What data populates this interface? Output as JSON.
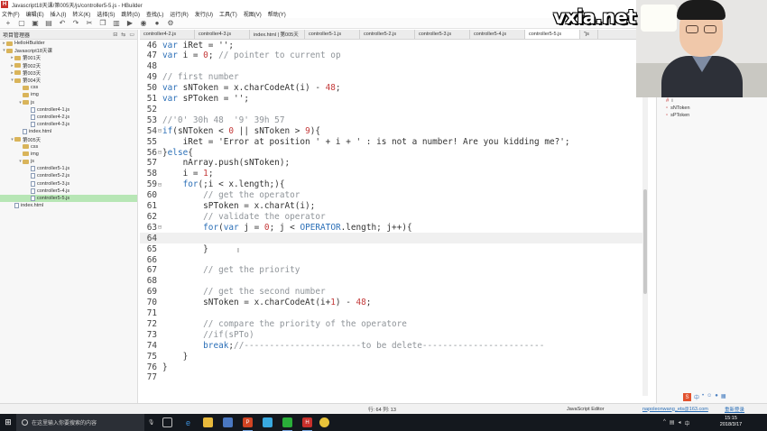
{
  "window": {
    "title": "Javascript18天课/第005天/js/controller5-5.js  -  HBuilder",
    "logo_letter": "H"
  },
  "menu": [
    "文件(F)",
    "编辑(E)",
    "插入(I)",
    "转义(K)",
    "选择(S)",
    "跳转(G)",
    "查找(L)",
    "运行(R)",
    "发行(U)",
    "工具(T)",
    "视图(V)",
    "帮助(Y)"
  ],
  "toolbar_icons": [
    "new-file-icon",
    "open-icon",
    "save-icon",
    "save-all-icon",
    "undo-icon",
    "redo-icon",
    "cut-icon",
    "copy-icon",
    "paste-icon",
    "run-icon",
    "browser-icon",
    "debug-icon",
    "settings-icon"
  ],
  "sidebar": {
    "title": "项目管理器",
    "items": [
      {
        "label": "HelloHBuilder",
        "depth": 0,
        "kind": "folder",
        "twisty": "▸"
      },
      {
        "label": "Javascript18天课",
        "depth": 0,
        "kind": "folder",
        "twisty": "▾"
      },
      {
        "label": "第001天",
        "depth": 1,
        "kind": "folder",
        "twisty": "▸"
      },
      {
        "label": "第002天",
        "depth": 1,
        "kind": "folder",
        "twisty": "▸"
      },
      {
        "label": "第003天",
        "depth": 1,
        "kind": "folder",
        "twisty": "▸"
      },
      {
        "label": "第004天",
        "depth": 1,
        "kind": "folder",
        "twisty": "▾"
      },
      {
        "label": "css",
        "depth": 2,
        "kind": "folder",
        "twisty": ""
      },
      {
        "label": "img",
        "depth": 2,
        "kind": "folder",
        "twisty": ""
      },
      {
        "label": "js",
        "depth": 2,
        "kind": "folder",
        "twisty": "▾"
      },
      {
        "label": "controller4-1.js",
        "depth": 3,
        "kind": "file",
        "twisty": ""
      },
      {
        "label": "controller4-2.js",
        "depth": 3,
        "kind": "file",
        "twisty": ""
      },
      {
        "label": "controller4-3.js",
        "depth": 3,
        "kind": "file",
        "twisty": ""
      },
      {
        "label": "index.html",
        "depth": 2,
        "kind": "file",
        "twisty": ""
      },
      {
        "label": "第005天",
        "depth": 1,
        "kind": "folder",
        "twisty": "▾"
      },
      {
        "label": "css",
        "depth": 2,
        "kind": "folder",
        "twisty": ""
      },
      {
        "label": "img",
        "depth": 2,
        "kind": "folder",
        "twisty": ""
      },
      {
        "label": "js",
        "depth": 2,
        "kind": "folder",
        "twisty": "▾"
      },
      {
        "label": "controller5-1.js",
        "depth": 3,
        "kind": "file",
        "twisty": ""
      },
      {
        "label": "controller5-2.js",
        "depth": 3,
        "kind": "file",
        "twisty": ""
      },
      {
        "label": "controller5-3.js",
        "depth": 3,
        "kind": "file",
        "twisty": ""
      },
      {
        "label": "controller5-4.js",
        "depth": 3,
        "kind": "file",
        "twisty": ""
      },
      {
        "label": "controller5-5.js",
        "depth": 3,
        "kind": "file",
        "twisty": "",
        "selected": true
      },
      {
        "label": "index.html",
        "depth": 1,
        "kind": "file",
        "twisty": ""
      }
    ]
  },
  "tabs": [
    {
      "label": "controller4-2.js"
    },
    {
      "label": "controller4-3.js"
    },
    {
      "label": "index.html | 第005天"
    },
    {
      "label": "controller5-1.js"
    },
    {
      "label": "controller5-2.js"
    },
    {
      "label": "controller5-3.js"
    },
    {
      "label": "controller5-4.js"
    },
    {
      "label": "controller5-5.js",
      "active": true
    },
    {
      "label": "\"js"
    }
  ],
  "editor": {
    "current_line": 64,
    "lines": [
      {
        "n": "46",
        "fold": "",
        "tokens": [
          [
            "kw",
            "var"
          ],
          [
            "idv",
            " iRet = "
          ],
          [
            "str",
            "''"
          ],
          [
            "idv",
            ";"
          ]
        ]
      },
      {
        "n": "47",
        "fold": "",
        "tokens": [
          [
            "kw",
            "var"
          ],
          [
            "idv",
            " i = "
          ],
          [
            "num",
            "0"
          ],
          [
            "idv",
            "; "
          ],
          [
            "cm",
            "// pointer to current op"
          ]
        ]
      },
      {
        "n": "48",
        "fold": "",
        "tokens": []
      },
      {
        "n": "49",
        "fold": "",
        "tokens": [
          [
            "cm",
            "// first number"
          ]
        ]
      },
      {
        "n": "50",
        "fold": "",
        "tokens": [
          [
            "kw",
            "var"
          ],
          [
            "idv",
            " sNToken = x.charCodeAt(i) - "
          ],
          [
            "num",
            "48"
          ],
          [
            "idv",
            ";"
          ]
        ]
      },
      {
        "n": "51",
        "fold": "",
        "tokens": [
          [
            "kw",
            "var"
          ],
          [
            "idv",
            " sPToken = "
          ],
          [
            "str",
            "''"
          ],
          [
            "idv",
            ";"
          ]
        ]
      },
      {
        "n": "52",
        "fold": "",
        "tokens": []
      },
      {
        "n": "53",
        "fold": "",
        "tokens": [
          [
            "cm",
            "//'0' 30h 48  '9' 39h 57"
          ]
        ]
      },
      {
        "n": "54",
        "fold": "⊟",
        "tokens": [
          [
            "kw",
            "if"
          ],
          [
            "idv",
            "(sNToken < "
          ],
          [
            "num",
            "0"
          ],
          [
            "idv",
            " || sNToken > "
          ],
          [
            "num",
            "9"
          ],
          [
            "idv",
            "){"
          ]
        ]
      },
      {
        "n": "55",
        "fold": "",
        "tokens": [
          [
            "idv",
            "    iRet = "
          ],
          [
            "str",
            "'Error at position ' + i + ' : is not a number! Are you kidding me?'"
          ],
          [
            "idv",
            ";"
          ]
        ]
      },
      {
        "n": "56",
        "fold": "⊟",
        "tokens": [
          [
            "idv",
            "}"
          ],
          [
            "kw",
            "else"
          ],
          [
            "idv",
            "{"
          ]
        ]
      },
      {
        "n": "57",
        "fold": "",
        "tokens": [
          [
            "idv",
            "    nArray.push(sNToken);"
          ]
        ]
      },
      {
        "n": "58",
        "fold": "",
        "tokens": [
          [
            "idv",
            "    i = "
          ],
          [
            "num",
            "1"
          ],
          [
            "idv",
            ";"
          ]
        ]
      },
      {
        "n": "59",
        "fold": "⊟",
        "tokens": [
          [
            "idv",
            "    "
          ],
          [
            "kw",
            "for"
          ],
          [
            "idv",
            "(;i < x.length;){"
          ]
        ]
      },
      {
        "n": "60",
        "fold": "",
        "tokens": [
          [
            "idv",
            "        "
          ],
          [
            "cm",
            "// get the operator"
          ]
        ]
      },
      {
        "n": "61",
        "fold": "",
        "tokens": [
          [
            "idv",
            "        sPToken = x.charAt(i);"
          ]
        ]
      },
      {
        "n": "62",
        "fold": "",
        "tokens": [
          [
            "idv",
            "        "
          ],
          [
            "cm",
            "// validate the operator"
          ]
        ]
      },
      {
        "n": "63",
        "fold": "⊟",
        "tokens": [
          [
            "idv",
            "        "
          ],
          [
            "kw",
            "for"
          ],
          [
            "idv",
            "("
          ],
          [
            "kw",
            "var"
          ],
          [
            "idv",
            " j = "
          ],
          [
            "num",
            "0"
          ],
          [
            "idv",
            "; j < "
          ],
          [
            "cst",
            "OPERATOR"
          ],
          [
            "idv",
            ".length; j++){"
          ]
        ]
      },
      {
        "n": "64",
        "fold": "",
        "tokens": []
      },
      {
        "n": "65",
        "fold": "",
        "tokens": [
          [
            "idv",
            "        }"
          ]
        ]
      },
      {
        "n": "66",
        "fold": "",
        "tokens": []
      },
      {
        "n": "67",
        "fold": "",
        "tokens": [
          [
            "idv",
            "        "
          ],
          [
            "cm",
            "// get the priority"
          ]
        ]
      },
      {
        "n": "68",
        "fold": "",
        "tokens": []
      },
      {
        "n": "69",
        "fold": "",
        "tokens": [
          [
            "idv",
            "        "
          ],
          [
            "cm",
            "// get the second number"
          ]
        ]
      },
      {
        "n": "70",
        "fold": "",
        "tokens": [
          [
            "idv",
            "        sNToken = x.charCodeAt(i+"
          ],
          [
            "num",
            "1"
          ],
          [
            "idv",
            ") - "
          ],
          [
            "num",
            "48"
          ],
          [
            "idv",
            ";"
          ]
        ]
      },
      {
        "n": "71",
        "fold": "",
        "tokens": []
      },
      {
        "n": "72",
        "fold": "",
        "tokens": [
          [
            "idv",
            "        "
          ],
          [
            "cm",
            "// compare the priority of the operatore"
          ]
        ]
      },
      {
        "n": "73",
        "fold": "",
        "tokens": [
          [
            "idv",
            "        "
          ],
          [
            "cm",
            "//if(sPTo)"
          ]
        ]
      },
      {
        "n": "74",
        "fold": "",
        "tokens": [
          [
            "idv",
            "        "
          ],
          [
            "kw",
            "break"
          ],
          [
            "idv",
            ";"
          ],
          [
            "cm",
            "//-----------------------to be delete------------------------"
          ]
        ]
      },
      {
        "n": "75",
        "fold": "",
        "tokens": [
          [
            "idv",
            "    }"
          ]
        ]
      },
      {
        "n": "76",
        "fold": "",
        "tokens": [
          [
            "idv",
            "}"
          ]
        ]
      },
      {
        "n": "77",
        "fold": "",
        "tokens": []
      }
    ]
  },
  "outline": {
    "items": [
      {
        "label": "i",
        "bullet": "#"
      },
      {
        "label": "sNToken",
        "bullet": "▫"
      },
      {
        "label": "sPToken",
        "bullet": "▫"
      }
    ]
  },
  "status": {
    "position": "行: 64 列: 13",
    "language": "JavaScript Editor",
    "user": "napoleonwang_ets@163.com",
    "login": "重新登录"
  },
  "watermark": "vxia.net",
  "taskbar": {
    "search_placeholder": "在这里输入你要搜索的内容",
    "time": "15:15",
    "date": "2018/3/17"
  }
}
